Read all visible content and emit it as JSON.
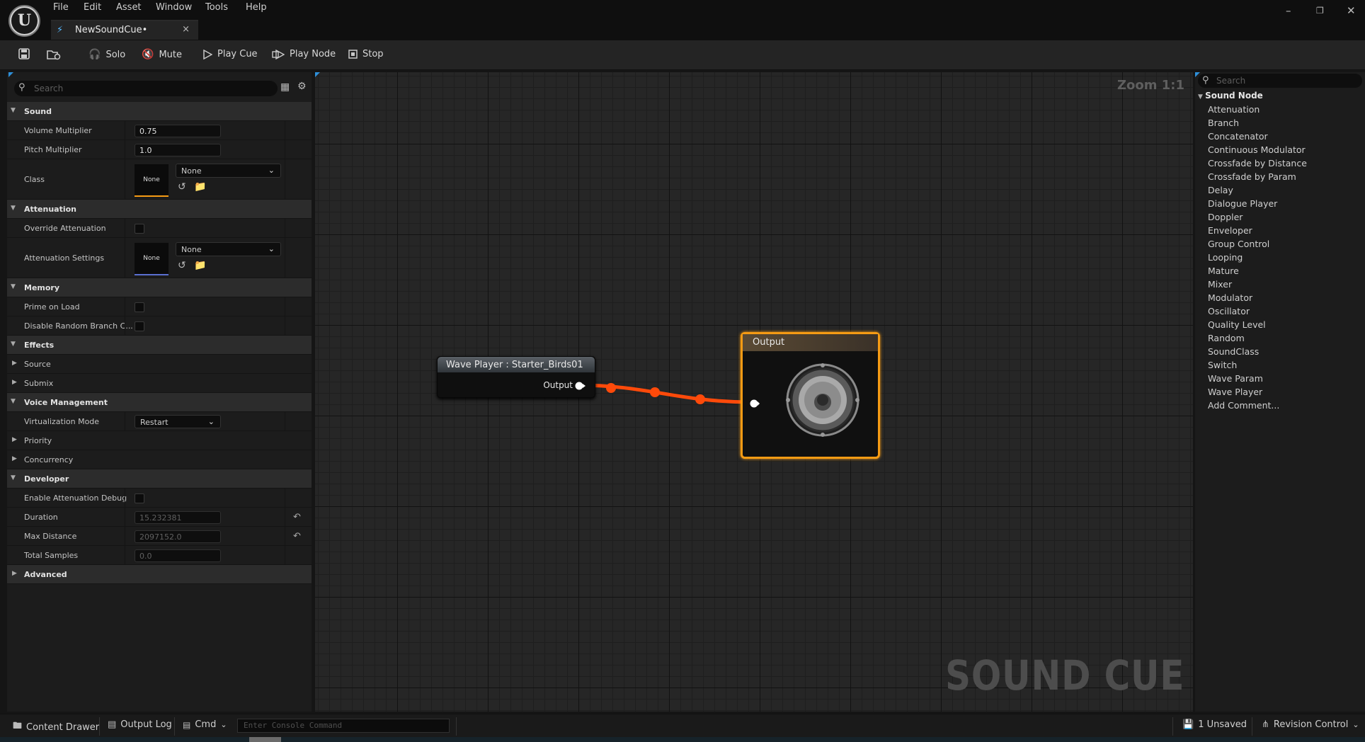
{
  "menu": [
    "File",
    "Edit",
    "Asset",
    "Window",
    "Tools",
    "Help"
  ],
  "tab": {
    "title": "NewSoundCue•",
    "close": "×"
  },
  "toolbar": {
    "solo": "Solo",
    "mute": "Mute",
    "play_cue": "Play Cue",
    "play_node": "Play Node",
    "stop": "Stop"
  },
  "details": {
    "search_placeholder": "Search",
    "rows": {
      "sound": "Sound",
      "volume_multiplier": {
        "label": "Volume Multiplier",
        "value": "0.75"
      },
      "pitch_multiplier": {
        "label": "Pitch Multiplier",
        "value": "1.0"
      },
      "class": {
        "label": "Class",
        "thumb": "None",
        "combo": "None"
      },
      "attenuation": "Attenuation",
      "override_attenuation": {
        "label": "Override Attenuation",
        "checked": false
      },
      "attenuation_settings": {
        "label": "Attenuation Settings",
        "thumb": "None",
        "combo": "None"
      },
      "memory": "Memory",
      "prime_on_load": {
        "label": "Prime on Load",
        "checked": false
      },
      "disable_random_branch": {
        "label": "Disable Random Branch C...",
        "checked": false
      },
      "effects": "Effects",
      "source": "Source",
      "submix": "Submix",
      "voice_management": "Voice Management",
      "virtualization_mode": {
        "label": "Virtualization Mode",
        "value": "Restart"
      },
      "priority": "Priority",
      "concurrency": "Concurrency",
      "developer": "Developer",
      "enable_attenuation_debug": {
        "label": "Enable Attenuation Debug",
        "checked": false
      },
      "duration": {
        "label": "Duration",
        "value": "15.232381"
      },
      "max_distance": {
        "label": "Max Distance",
        "value": "2097152.0"
      },
      "total_samples": {
        "label": "Total Samples",
        "value": "0.0"
      },
      "advanced": "Advanced"
    }
  },
  "graph": {
    "zoom": "Zoom 1:1",
    "watermark": "SOUND CUE",
    "wave_node": {
      "title": "Wave Player : Starter_Birds01",
      "output": "Output"
    },
    "output_node": {
      "title": "Output"
    },
    "wire_color": "#ff4a0a",
    "selection_color": "#f59b14"
  },
  "palette": {
    "search_placeholder": "Search",
    "category": "Sound Node",
    "items": [
      "Attenuation",
      "Branch",
      "Concatenator",
      "Continuous Modulator",
      "Crossfade by Distance",
      "Crossfade by Param",
      "Delay",
      "Dialogue Player",
      "Doppler",
      "Enveloper",
      "Group Control",
      "Looping",
      "Mature",
      "Mixer",
      "Modulator",
      "Oscillator",
      "Quality Level",
      "Random",
      "SoundClass",
      "Switch",
      "Wave Param",
      "Wave Player",
      "Add Comment..."
    ]
  },
  "statusbar": {
    "content_drawer": "Content Drawer",
    "output_log": "Output Log",
    "cmd": "Cmd",
    "console_placeholder": "Enter Console Command",
    "unsaved": "1 Unsaved",
    "revision_control": "Revision Control"
  }
}
